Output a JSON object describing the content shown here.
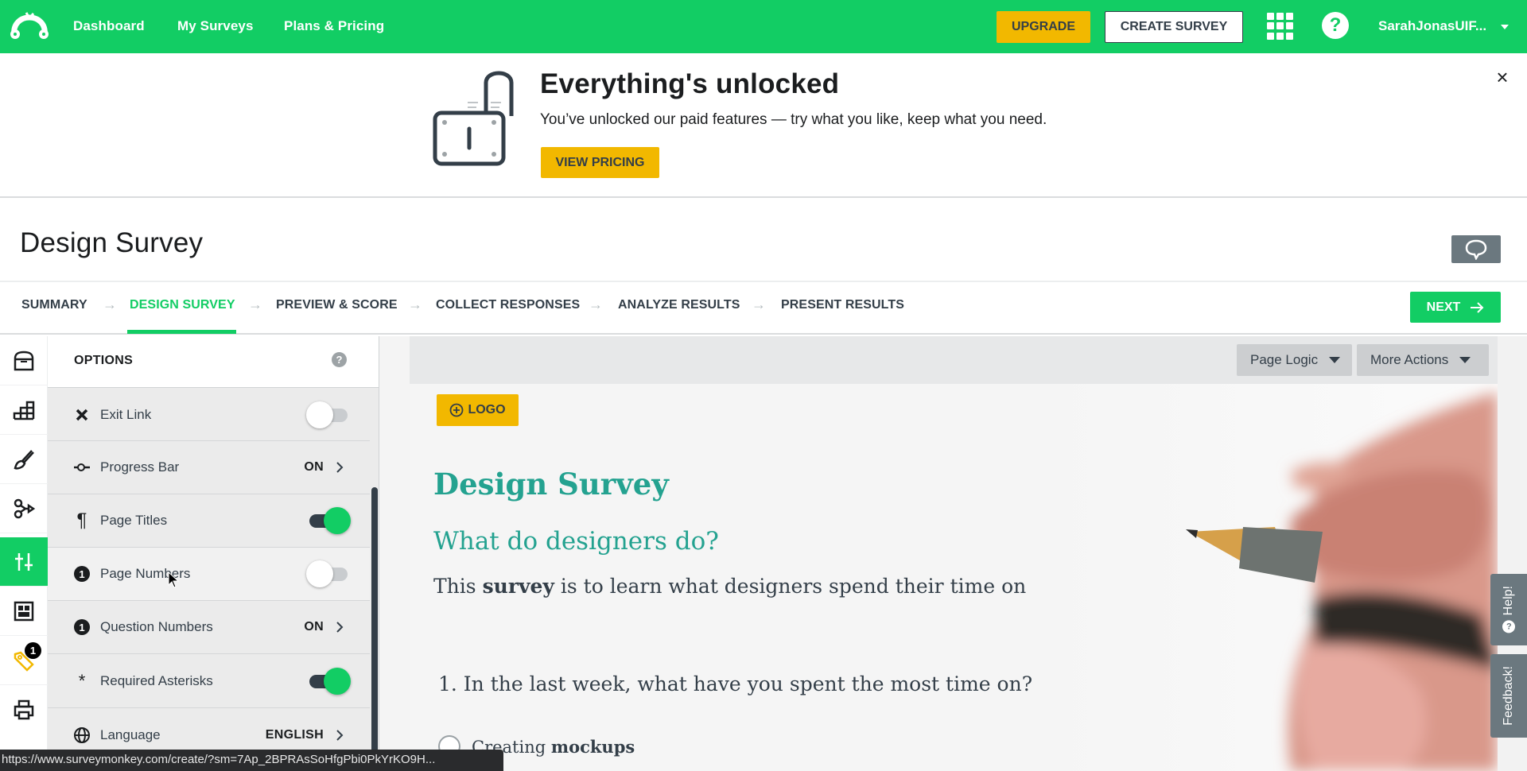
{
  "topnav": {
    "links": [
      "Dashboard",
      "My Surveys",
      "Plans & Pricing"
    ],
    "upgrade_label": "UPGRADE",
    "create_survey_label": "CREATE SURVEY",
    "help_glyph": "?",
    "user_name": "SarahJonasUIF...",
    "brand_color": "#12cd64"
  },
  "banner": {
    "title": "Everything's unlocked",
    "subtitle": "You’ve unlocked our paid features — try what you like, keep what you need.",
    "cta_label": "VIEW PRICING",
    "close_glyph": "×"
  },
  "page": {
    "title": "Design Survey",
    "next_label": "NEXT"
  },
  "tabs": [
    {
      "label": "SUMMARY",
      "active": false
    },
    {
      "label": "DESIGN SURVEY",
      "active": true
    },
    {
      "label": "PREVIEW & SCORE",
      "active": false
    },
    {
      "label": "COLLECT RESPONSES",
      "active": false
    },
    {
      "label": "ANALYZE RESULTS",
      "active": false
    },
    {
      "label": "PRESENT RESULTS",
      "active": false
    }
  ],
  "tab_separator": "→",
  "rail": {
    "items": [
      {
        "icon": "question-bank-icon"
      },
      {
        "icon": "builder-icon"
      },
      {
        "icon": "style-paintbrush-icon"
      },
      {
        "icon": "logic-icon"
      },
      {
        "icon": "options-sliders-icon",
        "active": true
      },
      {
        "icon": "layout-icon"
      },
      {
        "icon": "tag-icon",
        "badge": "1"
      },
      {
        "icon": "print-icon"
      }
    ]
  },
  "options_panel": {
    "title": "OPTIONS",
    "help_glyph": "?",
    "rows": [
      {
        "label": "Exit Link",
        "icon": "x-icon",
        "type": "toggle",
        "on": false
      },
      {
        "label": "Progress Bar",
        "icon": "progress-bar-icon",
        "type": "value",
        "value": "ON"
      },
      {
        "label": "Page Titles",
        "icon": "pilcrow-icon",
        "type": "toggle",
        "on": true
      },
      {
        "label": "Page Numbers",
        "icon": "number-icon",
        "badge": "1",
        "type": "toggle",
        "on": false
      },
      {
        "label": "Question Numbers",
        "icon": "number-icon",
        "badge": "1",
        "type": "value",
        "value": "ON"
      },
      {
        "label": "Required Asterisks",
        "icon": "asterisk-icon",
        "glyph": "*",
        "type": "toggle",
        "on": true
      },
      {
        "label": "Language",
        "icon": "globe-icon",
        "type": "value",
        "value": "ENGLISH"
      }
    ]
  },
  "canvas": {
    "page_logic_label": "Page Logic",
    "more_actions_label": "More Actions",
    "logo_label": "LOGO",
    "survey_title": "Design Survey",
    "page_title": "What do designers do?",
    "description_pre": "This ",
    "description_bold": "survey",
    "description_post": " is to learn what designers spend their time on",
    "question": "1. In the last week, what have you spent the most time on?",
    "option_pre": "Creating ",
    "option_bold": "mockups"
  },
  "side_tabs": {
    "help_label": "Help!",
    "help_glyph": "?",
    "feedback_label": "Feedback!"
  },
  "statusbar": {
    "url": "https://www.surveymonkey.com/create/?sm=7Ap_2BPRAsSoHfgPbi0PkYrKO9H..."
  }
}
